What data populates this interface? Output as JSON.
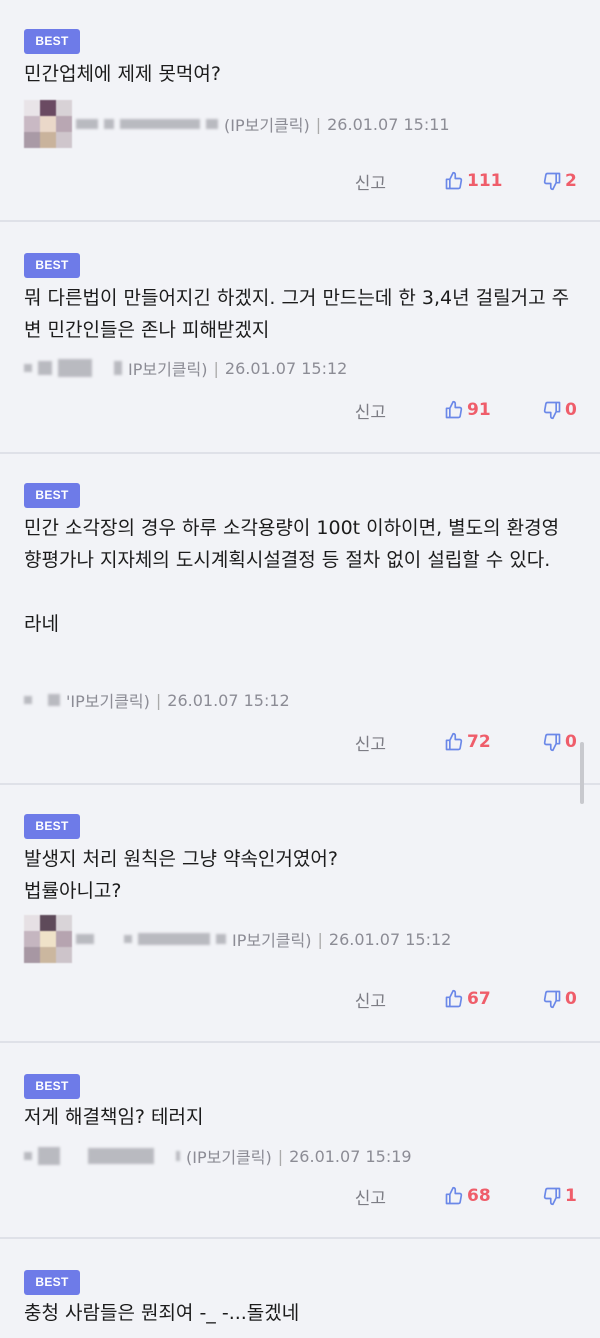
{
  "colors": {
    "badge": "#6e7be8",
    "vote": "#ef5d6a",
    "like_icon": "#6b88e8",
    "background": "#f2f3f7"
  },
  "common": {
    "badge_label": "BEST",
    "report_label": "신고"
  },
  "comments": [
    {
      "text": "민간업체에 제제 못먹여?",
      "ip_label": "(IP보기클릭)",
      "timestamp": "26.01.07 15:11",
      "likes": "111",
      "dislikes": "2",
      "has_avatar": true
    },
    {
      "text": "뭐 다른법이 만들어지긴 하겠지. 그거 만드는데 한 3,4년 걸릴거고 주변 민간인들은 존나 피해받겠지",
      "ip_label": "IP보기클릭)",
      "timestamp": "26.01.07 15:12",
      "likes": "91",
      "dislikes": "0",
      "has_avatar": false
    },
    {
      "text": "민간 소각장의 경우 하루 소각용량이 100t 이하이면, 별도의 환경영향평가나 지자체의 도시계획시설결정 등 절차 없이 설립할 수 있다.\n\n라네",
      "ip_label": "'IP보기클릭)",
      "timestamp": "26.01.07 15:12",
      "likes": "72",
      "dislikes": "0",
      "has_avatar": false
    },
    {
      "text": "발생지 처리 원칙은 그냥 약속인거였어?\n법률아니고?",
      "ip_label": "IP보기클릭)",
      "timestamp": "26.01.07 15:12",
      "likes": "67",
      "dislikes": "0",
      "has_avatar": true
    },
    {
      "text": "저게 해결책임? 테러지",
      "ip_label": "(IP보기클릭)",
      "timestamp": "26.01.07 15:19",
      "likes": "68",
      "dislikes": "1",
      "has_avatar": false
    },
    {
      "text": "충청 사람들은 뭔죄여 -_ -...돌겠네",
      "has_avatar": false
    }
  ]
}
